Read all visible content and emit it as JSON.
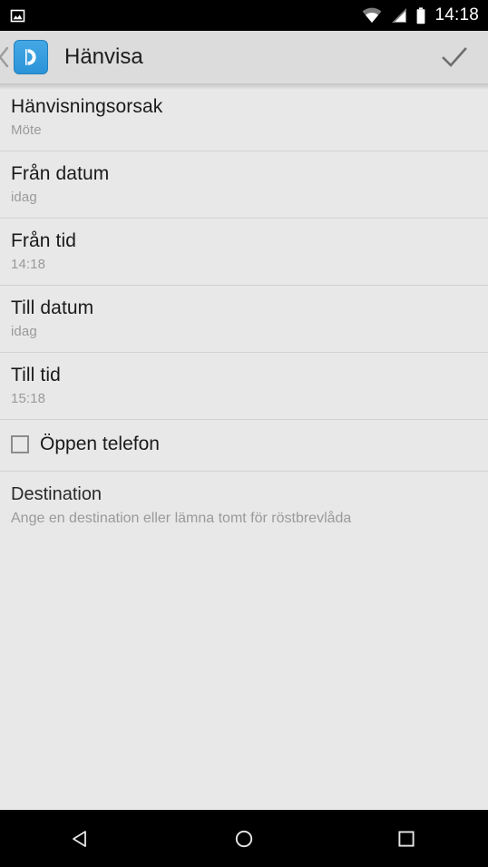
{
  "status_bar": {
    "notification_icon": "image-notification-icon",
    "wifi_icon": "wifi-icon",
    "signal_icon": "cellular-signal-icon",
    "battery_icon": "battery-icon",
    "clock": "14:18",
    "background": "#000000",
    "foreground": "#ffffff"
  },
  "action_bar": {
    "up_icon": "back-chevron-icon",
    "app_icon": "phone-handset-icon",
    "app_icon_color": "#2b93d8",
    "title": "Hänvisa",
    "done_icon": "checkmark-icon",
    "background": "#dcdcdc"
  },
  "list": {
    "rows": [
      {
        "title": "Hänvisningsorsak",
        "value": "Möte"
      },
      {
        "title": "Från datum",
        "value": "idag"
      },
      {
        "title": "Från tid",
        "value": "14:18"
      },
      {
        "title": "Till datum",
        "value": "idag"
      },
      {
        "title": "Till tid",
        "value": "15:18"
      }
    ],
    "checkbox_row": {
      "label": "Öppen telefon",
      "checked": false
    },
    "destination": {
      "title": "Destination",
      "hint": "Ange en destination eller lämna tomt för röstbrevlåda"
    },
    "background": "#e8e8e8",
    "divider_color": "#d2d2d2"
  },
  "nav_bar": {
    "back_icon": "back-triangle-icon",
    "home_icon": "home-circle-icon",
    "recents_icon": "recents-square-icon",
    "background": "#000000"
  }
}
